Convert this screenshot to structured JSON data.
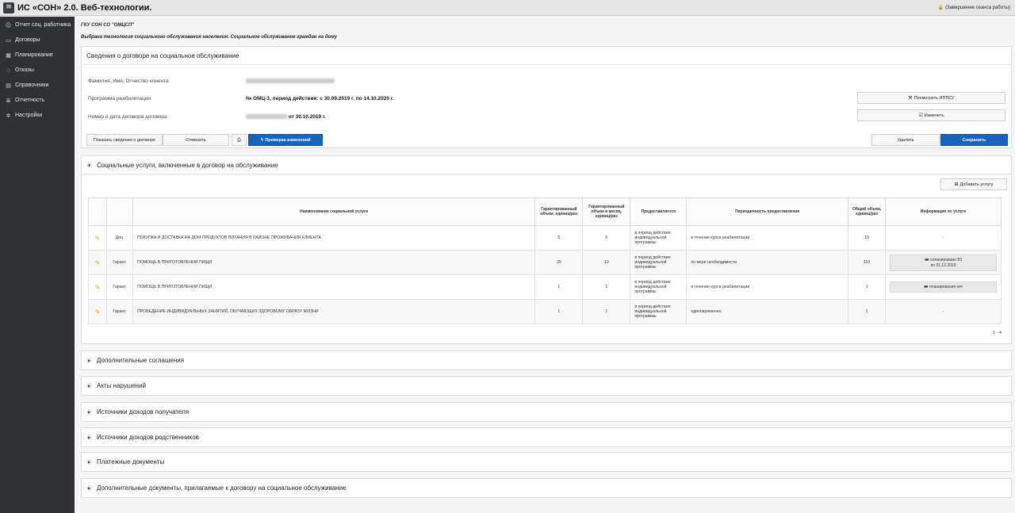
{
  "header": {
    "title": "ИС «СОН» 2.0. Веб-технологии.",
    "logout": "(Завершение сеанса работы)"
  },
  "sidebar": {
    "items": [
      {
        "label": "Отчет соц. работника",
        "icon": "person-icon",
        "glyph": "☺"
      },
      {
        "label": "Договоры",
        "icon": "folder-icon",
        "glyph": "▭"
      },
      {
        "label": "Планирование",
        "icon": "calendar-icon",
        "glyph": "▦"
      },
      {
        "label": "Отказы",
        "icon": "bell-icon",
        "glyph": "♢"
      },
      {
        "label": "Справочники",
        "icon": "book-icon",
        "glyph": "▤"
      },
      {
        "label": "Отчетность",
        "icon": "list-icon",
        "glyph": "≣"
      },
      {
        "label": "Настройки",
        "icon": "gears-icon",
        "glyph": "✲"
      }
    ]
  },
  "main": {
    "org": "ГКУ СОН СО \"ОМЦСП\"",
    "technology": "Выбрана технология социального обслуживания населения: Социальное обслуживание граждан на дому"
  },
  "contract": {
    "heading": "Сведения о договоре на социальное обслуживание",
    "fio_label": "Фамилия, Имя, Отчество клиента",
    "program_label": "Программа реабилитации",
    "program_value": "№ ОМЦ-3, период действия: с 30.09.2019 г. по 14.10.2020 г.",
    "number_label": "Номер и дата договора договора",
    "number_value": "от 30.10.2019 г.",
    "btn_view_ippsu": "Посмотреть ИППСУ",
    "btn_edit": "Изменить",
    "btn_show": "Показать сведения о договоре",
    "btn_cancel": "Отменить",
    "btn_check": "Проверка изменений",
    "btn_delete": "Удалить",
    "btn_save": "Сохранить"
  },
  "services": {
    "heading": "Социальные услуги, включенные в договор на обслуживание",
    "btn_add": "Добавить услугу",
    "columns": [
      "",
      "",
      "Наименование социальной услуги",
      "Гарантированный объем, единиц/раз",
      "Гарантированный объем в месяц, единиц/раз",
      "Предоставляется",
      "Периодичность предоставления",
      "Общий объем, единиц/раз",
      "Информация по услуге"
    ],
    "rows": [
      {
        "type": "Доп.",
        "name": "ПОКУПКА И ДОСТАВКА НА ДОМ ПРОДУКТОВ ПИТАНИЯ В РАЙОНЕ ПРОЖИВАНИЯ КЛИЕНТА",
        "vol": "5",
        "vol_month": "5",
        "provided": "в период действия индивидуальной программы",
        "period": "в течение курса реабилитации",
        "total": "10",
        "info": "-",
        "info_line2": ""
      },
      {
        "type": "Гарант.",
        "name": "ПОМОЩЬ В ПРИГОТОВЛЕНИИ ПИЩИ",
        "vol": "25",
        "vol_month": "10",
        "provided": "в период действия индивидуальной программы",
        "period": "по мере необходимости",
        "total": "110",
        "info": "спланировано 83",
        "info_line2": "по 31.12.2020"
      },
      {
        "type": "Гарант.",
        "name": "ПОМОЩЬ В ПРИГОТОВЛЕНИИ ПИЩИ",
        "vol": "1",
        "vol_month": "1",
        "provided": "в период действия индивидуальной программы",
        "period": "в течение курса реабилитации",
        "total": "1",
        "info": "планирования нет",
        "info_line2": ""
      },
      {
        "type": "Гарант.",
        "name": "ПРОВЕДЕНИЕ ИНДИВИДУАЛЬНЫХ ЗАНЯТИЙ, ОБУЧАЮЩИХ ЗДОРОВОМУ ОБРАЗУ ЖИЗНИ",
        "vol": "1",
        "vol_month": "1",
        "provided": "в период действия индивидуальной программы",
        "period": "единовременно",
        "total": "1",
        "info": "-",
        "info_line2": ""
      }
    ],
    "pager": "1 - 4"
  },
  "sections": [
    "Дополнительные соглашения",
    "Акты нарушений",
    "Источники доходов получателя",
    "Источники доходов родственников",
    "Платежные документы",
    "Дополнительные документы, прилагаемые к договору на социальное обслуживание"
  ],
  "colors": {
    "accent": "#1565c0",
    "sidebar": "#2f3135",
    "pencil": "#e6a100"
  }
}
